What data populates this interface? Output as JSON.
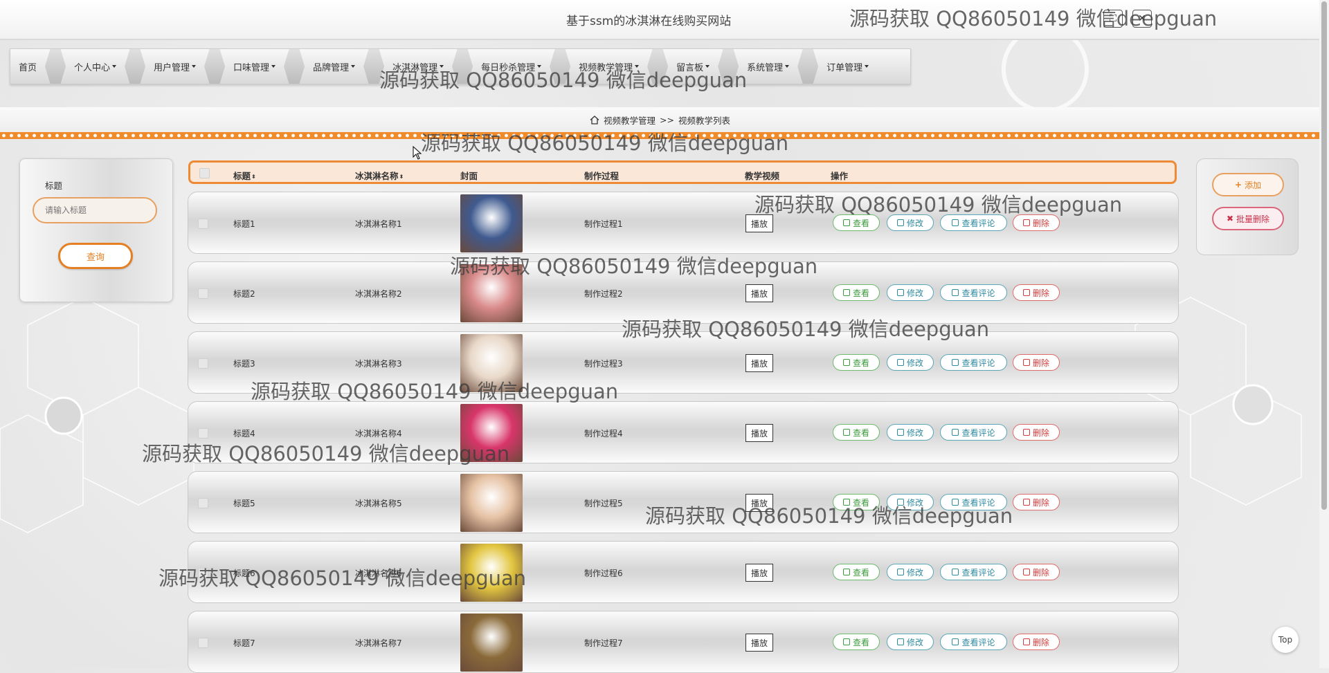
{
  "app": {
    "title": "基于ssm的冰淇淋在线购买网站"
  },
  "nav": {
    "items": [
      {
        "label": "首页",
        "dropdown": false
      },
      {
        "label": "个人中心",
        "dropdown": true
      },
      {
        "label": "用户管理",
        "dropdown": true
      },
      {
        "label": "口味管理",
        "dropdown": true
      },
      {
        "label": "品牌管理",
        "dropdown": true
      },
      {
        "label": "冰淇淋管理",
        "dropdown": true
      },
      {
        "label": "每日秒杀管理",
        "dropdown": true
      },
      {
        "label": "视频教学管理",
        "dropdown": true
      },
      {
        "label": "留言板",
        "dropdown": true
      },
      {
        "label": "系统管理",
        "dropdown": true
      },
      {
        "label": "订单管理",
        "dropdown": true
      }
    ]
  },
  "breadcrumb": {
    "section": "视频教学管理",
    "separator": ">>",
    "page": "视频教学列表"
  },
  "search": {
    "label": "标题",
    "placeholder": "请输入标题",
    "button": "查询"
  },
  "actions": {
    "add": "添加",
    "batch_delete": "批量删除"
  },
  "table": {
    "headers": {
      "title": "标题",
      "name": "冰淇淋名称",
      "cover": "封面",
      "process": "制作过程",
      "video": "教学视频",
      "ops": "操作"
    },
    "play_label": "播放",
    "op_labels": {
      "view": "查看",
      "edit": "修改",
      "comments": "查看评论",
      "delete": "删除"
    },
    "rows": [
      {
        "title": "标题1",
        "name": "冰淇淋名称1",
        "process": "制作过程1",
        "cover_color": "#3f5a8f"
      },
      {
        "title": "标题2",
        "name": "冰淇淋名称2",
        "process": "制作过程2",
        "cover_color": "#d98a8a"
      },
      {
        "title": "标题3",
        "name": "冰淇淋名称3",
        "process": "制作过程3",
        "cover_color": "#e8d8c8"
      },
      {
        "title": "标题4",
        "name": "冰淇淋名称4",
        "process": "制作过程4",
        "cover_color": "#d8356a"
      },
      {
        "title": "标题5",
        "name": "冰淇淋名称5",
        "process": "制作过程5",
        "cover_color": "#e6c2a4"
      },
      {
        "title": "标题6",
        "name": "冰淇淋名称6",
        "process": "制作过程6",
        "cover_color": "#e2c640"
      },
      {
        "title": "标题7",
        "name": "冰淇淋名称7",
        "process": "制作过程7",
        "cover_color": "#8a6a3a"
      }
    ]
  },
  "top_button": "Top",
  "watermark": "源码获取 QQ86050149 微信deepguan",
  "colors": {
    "accent": "#ee8a35",
    "danger": "#d03b3b",
    "success": "#3c9a3c",
    "info": "#2f8aa0"
  }
}
